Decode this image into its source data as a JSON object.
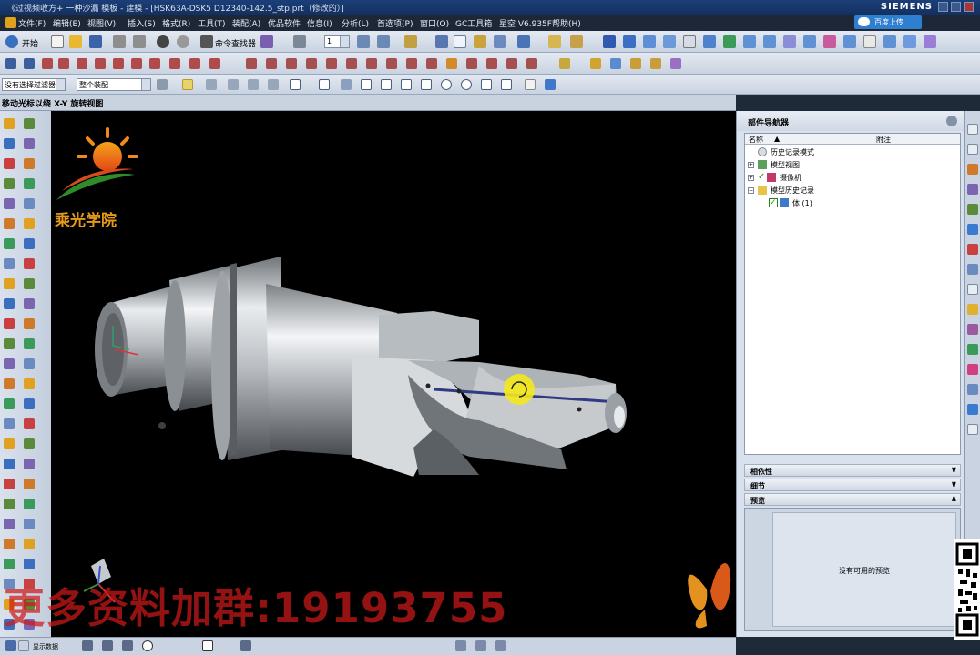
{
  "titlebar": {
    "title": "《过视频收方+ 一种沙漏 模板 - 建模 - [HSK63A-DSK5 D12340-142.5_stp.prt（修改的）]",
    "brand": "SIEMENS"
  },
  "menu": {
    "items": [
      "文件(F)",
      "编辑(E)",
      "视图(V)",
      "插入(S)",
      "格式(R)",
      "工具(T)",
      "装配(A)",
      "优品软件",
      "信息(I)",
      "分析(L)",
      "首选项(P)",
      "窗口(O)",
      "GC工具箱",
      "星空 V6.935F",
      "帮助(H)"
    ],
    "cloud_button": "百度上传"
  },
  "toolbar": {
    "start_label": "开始",
    "command_finder": "命令查找器",
    "filter_value": "没有选择过滤器",
    "assembly_scope": "整个装配",
    "layer_value": "1"
  },
  "statusline": {
    "prompt": "移动光标以绕 X-Y 旋转视图"
  },
  "logo": {
    "text": "乘光学院"
  },
  "navigator": {
    "title": "部件导航器",
    "col_name": "名称",
    "col_note": "附注",
    "tree": [
      {
        "label": "历史记录模式",
        "icon": "history-icon"
      },
      {
        "label": "模型视图",
        "icon": "model-view-icon"
      },
      {
        "label": "摄像机",
        "icon": "camera-icon"
      },
      {
        "label": "模型历史记录",
        "icon": "folder-icon"
      },
      {
        "label": "体 (1)",
        "icon": "body-icon"
      }
    ],
    "sections": [
      "相依性",
      "细节",
      "预览"
    ],
    "preview_empty": "没有可用的预览"
  },
  "bottom": {
    "label": "显示数据"
  },
  "watermark": {
    "text": "更多资料加群:19193755"
  },
  "colors": {
    "viewport_bg": "#000000",
    "titlebar": "#1b3f7a",
    "toolbar": "#d6dee9",
    "watermark": "#cd1919",
    "cursor_highlight": "#f4e81c"
  }
}
